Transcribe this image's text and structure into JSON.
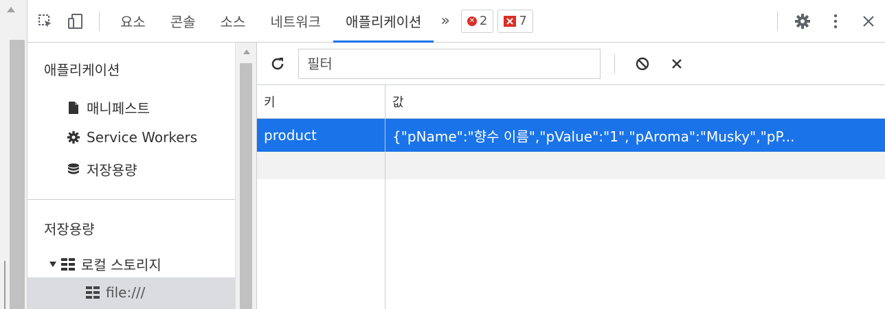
{
  "toolbar": {
    "tabs": [
      "요소",
      "콘솔",
      "소스",
      "네트워크",
      "애플리케이션"
    ],
    "more": "»",
    "error_count": "2",
    "issue_count": "7",
    "error_flag": "✕"
  },
  "sidebar": {
    "app_header": "애플리케이션",
    "app_items": [
      "매니페스트",
      "Service Workers",
      "저장용량"
    ],
    "storage_header": "저장용량",
    "local_storage": "로컬 스토리지",
    "file_origin": "file:///"
  },
  "main": {
    "filter_placeholder": "필터",
    "table": {
      "columns": [
        "키",
        "값"
      ],
      "rows": [
        {
          "key": "product",
          "value": "{\"pName\":\"향수 이름\",\"pValue\":\"1\",\"pAroma\":\"Musky\",\"pP..."
        }
      ]
    }
  },
  "colors": {
    "accent": "#1a73e8",
    "error": "#d93025",
    "selected_bg": "#dadce0"
  }
}
